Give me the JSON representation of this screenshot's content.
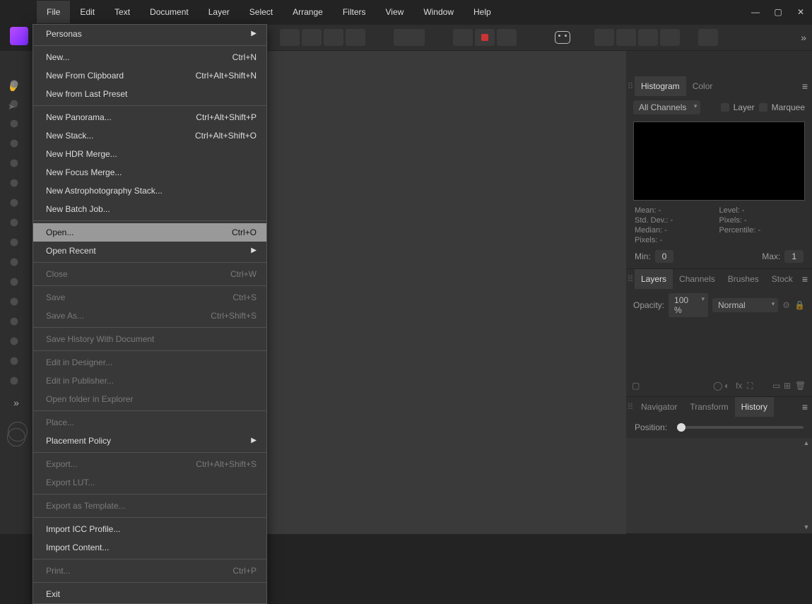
{
  "menubar": [
    "File",
    "Edit",
    "Text",
    "Document",
    "Layer",
    "Select",
    "Arrange",
    "Filters",
    "View",
    "Window",
    "Help"
  ],
  "menubar_active_index": 0,
  "file_menu": {
    "highlight_index": 10,
    "items": [
      {
        "label": "Personas",
        "sub": true
      },
      {
        "sep": true
      },
      {
        "label": "New...",
        "key": "Ctrl+N"
      },
      {
        "label": "New From Clipboard",
        "key": "Ctrl+Alt+Shift+N"
      },
      {
        "label": "New from Last Preset"
      },
      {
        "sep": true
      },
      {
        "label": "New Panorama...",
        "key": "Ctrl+Alt+Shift+P"
      },
      {
        "label": "New Stack...",
        "key": "Ctrl+Alt+Shift+O"
      },
      {
        "label": "New HDR Merge..."
      },
      {
        "label": "New Focus Merge..."
      },
      {
        "label": "New Astrophotography Stack..."
      },
      {
        "label": "New Batch Job..."
      },
      {
        "sep": true
      },
      {
        "label": "Open...",
        "key": "Ctrl+O",
        "highlight": true
      },
      {
        "label": "Open Recent",
        "sub": true
      },
      {
        "sep": true
      },
      {
        "label": "Close",
        "key": "Ctrl+W",
        "disabled": true
      },
      {
        "sep": true
      },
      {
        "label": "Save",
        "key": "Ctrl+S",
        "disabled": true
      },
      {
        "label": "Save As...",
        "key": "Ctrl+Shift+S",
        "disabled": true
      },
      {
        "sep": true
      },
      {
        "label": "Save History With Document",
        "disabled": true
      },
      {
        "sep": true
      },
      {
        "label": "Edit in Designer...",
        "disabled": true
      },
      {
        "label": "Edit in Publisher...",
        "disabled": true
      },
      {
        "label": "Open folder in Explorer",
        "disabled": true
      },
      {
        "sep": true
      },
      {
        "label": "Place...",
        "disabled": true
      },
      {
        "label": "Placement Policy",
        "sub": true
      },
      {
        "sep": true
      },
      {
        "label": "Export...",
        "key": "Ctrl+Alt+Shift+S",
        "disabled": true
      },
      {
        "label": "Export LUT...",
        "disabled": true
      },
      {
        "sep": true
      },
      {
        "label": "Export as Template...",
        "disabled": true
      },
      {
        "sep": true
      },
      {
        "label": "Import ICC Profile..."
      },
      {
        "label": "Import Content..."
      },
      {
        "sep": true
      },
      {
        "label": "Print...",
        "key": "Ctrl+P",
        "disabled": true
      },
      {
        "sep": true
      },
      {
        "label": "Exit"
      }
    ]
  },
  "panels": {
    "histogram": {
      "tabs": [
        "Histogram",
        "Color"
      ],
      "active": 0,
      "channels_label": "All Channels",
      "layer": "Layer",
      "marquee": "Marquee",
      "stats": {
        "mean": "Mean: -",
        "level": "Level: -",
        "std": "Std. Dev.: -",
        "px": "Pixels: -",
        "median": "Median: -",
        "pct": "Percentile: -",
        "pixels": "Pixels: -"
      },
      "min_label": "Min:",
      "min_val": "0",
      "max_label": "Max:",
      "max_val": "1"
    },
    "layers": {
      "tabs": [
        "Layers",
        "Channels",
        "Brushes",
        "Stock"
      ],
      "active": 0,
      "opacity_label": "Opacity:",
      "opacity_val": "100 %",
      "blend": "Normal"
    },
    "history": {
      "tabs": [
        "Navigator",
        "Transform",
        "History"
      ],
      "active": 2,
      "position_label": "Position:"
    }
  },
  "tool_names": [
    "hand",
    "move",
    "brush",
    "crop",
    "lasso",
    "marquee",
    "clone",
    "heal",
    "paint",
    "burn",
    "sponge",
    "dodge",
    "smudge",
    "blur",
    "sharpen",
    "eyedrop"
  ]
}
